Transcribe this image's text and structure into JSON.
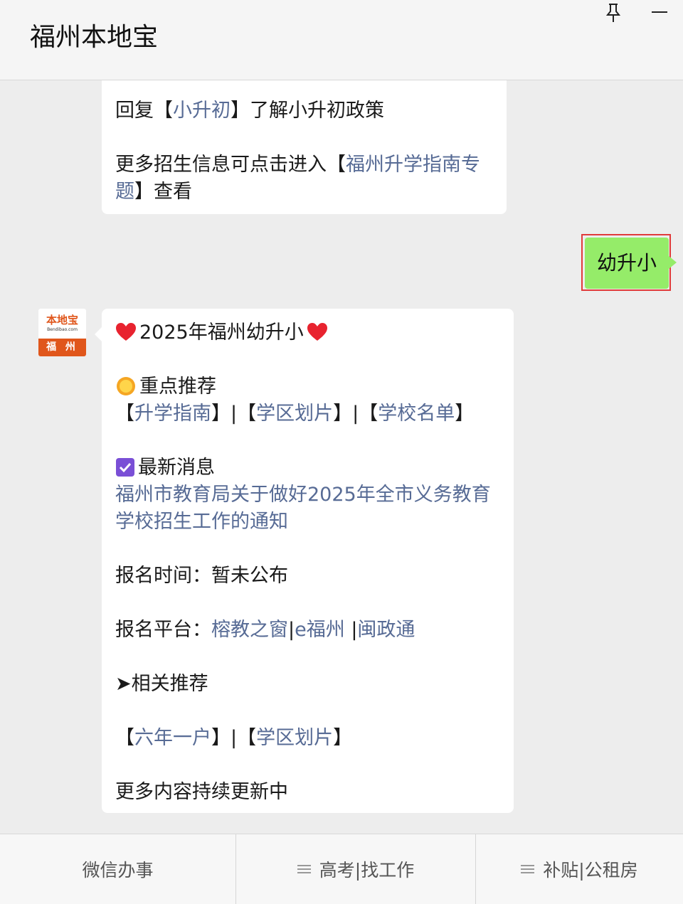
{
  "window": {
    "title": "福州本地宝"
  },
  "messages": {
    "reply1": {
      "line1": {
        "pre": "回复【",
        "link": "小升初",
        "post": "】了解小升初政策"
      },
      "line2": {
        "pre": "更多招生信息可点击进入【",
        "link_a": "福州升学指南专"
      },
      "line3": {
        "link_b": "题",
        "post": "】查看"
      }
    },
    "user_message": "幼升小",
    "avatar": {
      "brand": "本地宝",
      "url": "Bendibao.com",
      "city": "福 州"
    },
    "reply2": {
      "title": "2025年福州幼升小",
      "section1_title": "重点推荐",
      "section1_links": {
        "b1": "【",
        "l1": "升学指南",
        "s1": "】|【",
        "l2": "学区划片",
        "s2": "】|【",
        "l3": "学校名单",
        "b2": "】"
      },
      "section2_title": "最新消息",
      "news_line1": "福州市教育局关于做好2025年全市义务教育",
      "news_line2": "学校招生工作的通知",
      "reg_time": "报名时间：暂未公布",
      "platform": {
        "label": "报名平台：",
        "l1": "榕教之窗",
        "sep1": "|",
        "l2": "e福州 ",
        "sep2": "|",
        "l3": "闽政通"
      },
      "related_title": "➤相关推荐",
      "related_links": {
        "b1": "【",
        "l1": "六年一户",
        "s1": "】|【",
        "l2": "学区划片",
        "b2": "】"
      },
      "footer": "更多内容持续更新中"
    }
  },
  "menu": [
    {
      "label": "微信办事",
      "has_icon": false
    },
    {
      "label": "高考|找工作",
      "has_icon": true
    },
    {
      "label": "补贴|公租房",
      "has_icon": true
    }
  ],
  "icons": {
    "pin": "pin-icon",
    "minimize": "minimize-icon",
    "heart": "heart-icon",
    "sun": "sun-icon",
    "check": "check-box-icon",
    "menu": "menu-lines-icon"
  },
  "colors": {
    "link": "#576b95",
    "user_bubble": "#95ec69",
    "highlight": "#e03b3b",
    "brand": "#e0561b"
  }
}
